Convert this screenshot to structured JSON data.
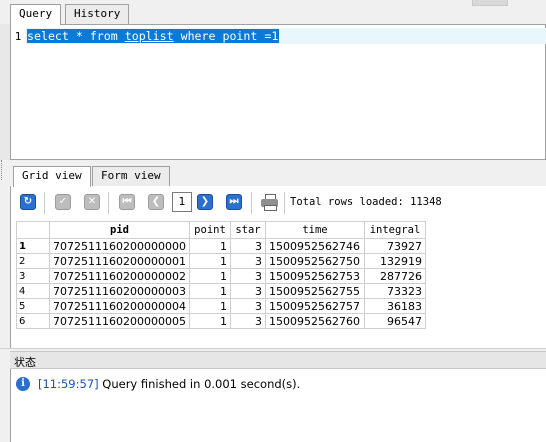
{
  "top_tabs": [
    {
      "label": "Query"
    },
    {
      "label": "History"
    }
  ],
  "editor": {
    "line_number": "1",
    "code": {
      "part1": "select * from ",
      "table": "toplist",
      "part2": " where point =1"
    }
  },
  "result_tabs": [
    {
      "label": "Grid view"
    },
    {
      "label": "Form view"
    }
  ],
  "toolbar": {
    "icons": [
      "refresh-icon",
      "check-icon",
      "cancel-icon",
      "first-page-icon",
      "prev-page-icon",
      "next-page-icon",
      "last-page-icon",
      "print-icon"
    ],
    "page": "1",
    "total_rows": "Total rows loaded: 11348"
  },
  "grid": {
    "columns": [
      "pid",
      "point",
      "star",
      "time",
      "integral"
    ],
    "rows": [
      {
        "n": "1",
        "pid": "7072511160200000000",
        "point": "1",
        "star": "3",
        "time": "1500952562746",
        "integral": "73927"
      },
      {
        "n": "2",
        "pid": "7072511160200000001",
        "point": "1",
        "star": "3",
        "time": "1500952562750",
        "integral": "132919"
      },
      {
        "n": "3",
        "pid": "7072511160200000002",
        "point": "1",
        "star": "3",
        "time": "1500952562753",
        "integral": "287726"
      },
      {
        "n": "4",
        "pid": "7072511160200000003",
        "point": "1",
        "star": "3",
        "time": "1500952562755",
        "integral": "73323"
      },
      {
        "n": "5",
        "pid": "7072511160200000004",
        "point": "1",
        "star": "3",
        "time": "1500952562757",
        "integral": "36183"
      },
      {
        "n": "6",
        "pid": "7072511160200000005",
        "point": "1",
        "star": "3",
        "time": "1500952562760",
        "integral": "96547"
      }
    ]
  },
  "status": {
    "title": "状态",
    "timestamp": "[11:59:57]",
    "message": "Query finished in 0.001 second(s)."
  }
}
